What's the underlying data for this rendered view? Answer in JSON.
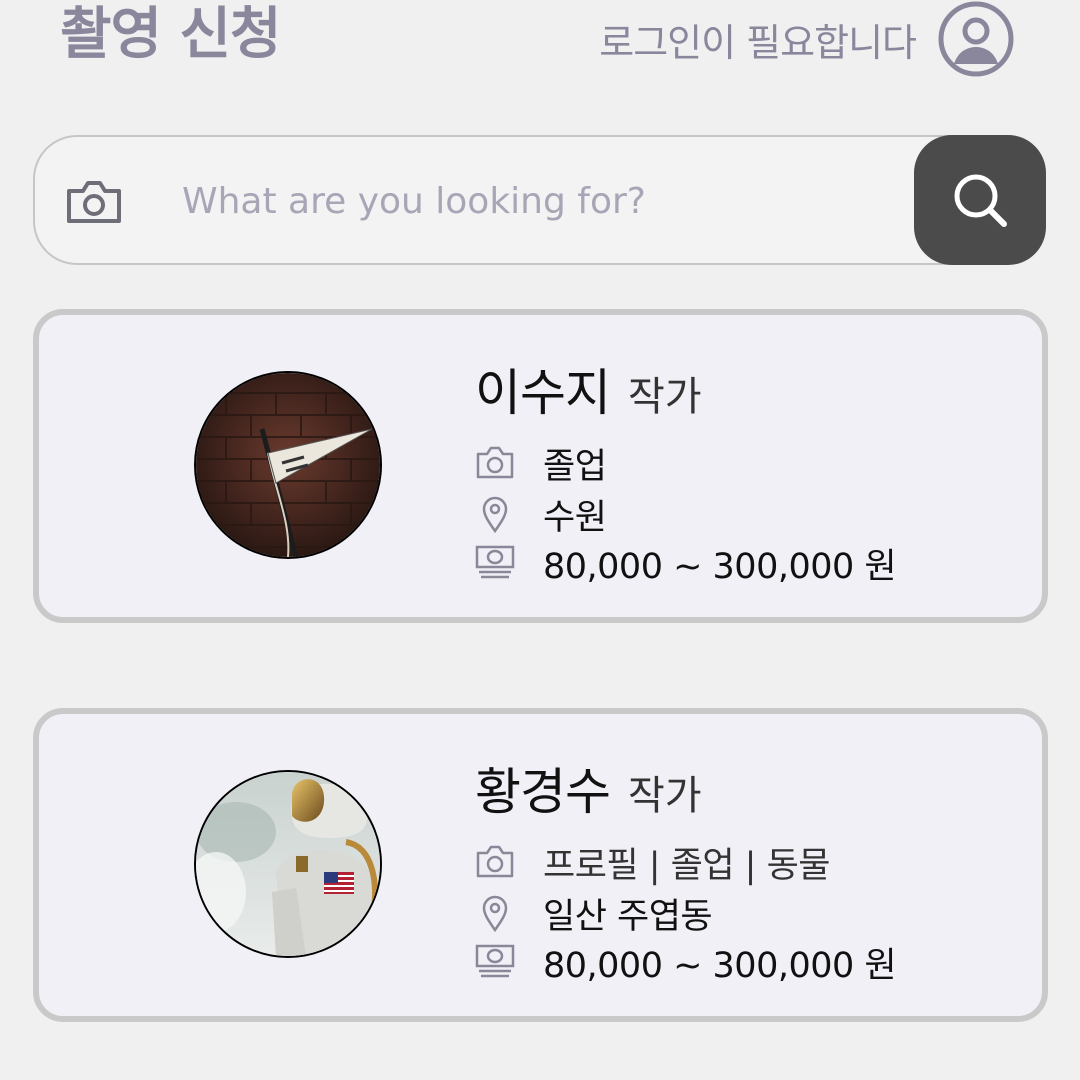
{
  "header": {
    "title": "촬영 신청",
    "login_text": "로그인이 필요합니다"
  },
  "search": {
    "placeholder": "What are you looking for?"
  },
  "cards": [
    {
      "name": "이수지",
      "role": "작가",
      "type": "졸업",
      "location": "수원",
      "price": "80,000 ~ 300,000 원"
    },
    {
      "name": "황경수",
      "role": "작가",
      "type": "프로필 | 졸업 | 동물",
      "location": "일산 주엽동",
      "price": "80,000 ~ 300,000 원"
    }
  ],
  "icons": {
    "avatar": "user-circle-icon",
    "camera": "camera-icon",
    "search": "search-icon",
    "location": "map-pin-icon",
    "price": "money-icon"
  },
  "colors": {
    "accent_text": "#8a879d",
    "search_button": "#4b4b4b",
    "card_background": "#f0f0f6",
    "card_border": "#c9c9c9"
  }
}
